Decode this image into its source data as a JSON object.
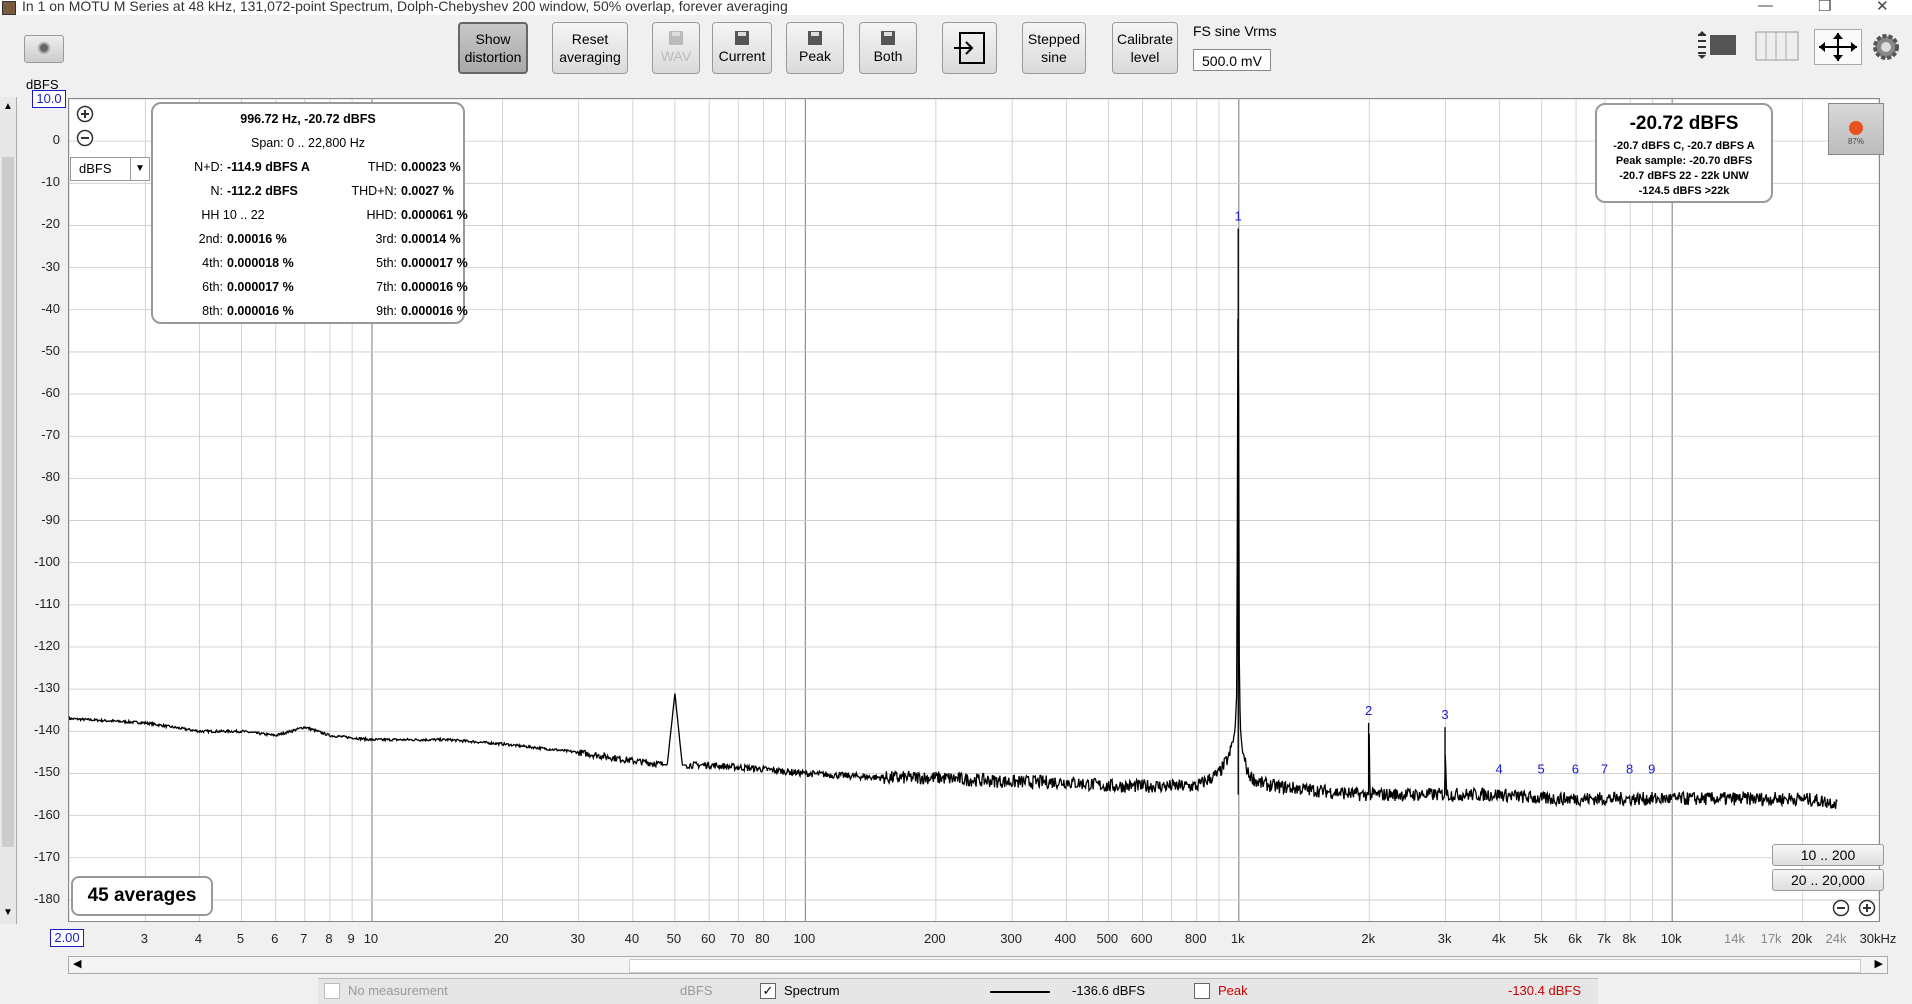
{
  "window": {
    "title": "In 1 on MOTU M Series at 48 kHz, 131,072-point Spectrum, Dolph-Chebyshev 200 window, 50% overlap, forever averaging"
  },
  "toolbar": {
    "show_distortion": "Show\ndistortion",
    "reset_averaging": "Reset\naveraging",
    "wav": "WAV",
    "current": "Current",
    "peak": "Peak",
    "both": "Both",
    "stepped_sine": "Stepped\nsine",
    "calibrate_level": "Calibrate\nlevel",
    "fs_label": "FS sine Vrms",
    "fs_value": "500.0 mV"
  },
  "axis": {
    "y_unit": "dBFS",
    "y_top_value": "10.0",
    "y_ticks": [
      "0",
      "-10",
      "-20",
      "-30",
      "-40",
      "-50",
      "-60",
      "-70",
      "-80",
      "-90",
      "-100",
      "-110",
      "-120",
      "-130",
      "-140",
      "-150",
      "-160",
      "-170",
      "-180"
    ],
    "unit_select": "dBFS",
    "x_start_value": "2.00",
    "x_ticks": [
      {
        "label": "3",
        "f": 3
      },
      {
        "label": "4",
        "f": 4
      },
      {
        "label": "5",
        "f": 5
      },
      {
        "label": "6",
        "f": 6
      },
      {
        "label": "7",
        "f": 7
      },
      {
        "label": "8",
        "f": 8
      },
      {
        "label": "9",
        "f": 9
      },
      {
        "label": "10",
        "f": 10
      },
      {
        "label": "20",
        "f": 20
      },
      {
        "label": "30",
        "f": 30
      },
      {
        "label": "40",
        "f": 40
      },
      {
        "label": "50",
        "f": 50
      },
      {
        "label": "60",
        "f": 60
      },
      {
        "label": "70",
        "f": 70
      },
      {
        "label": "80",
        "f": 80
      },
      {
        "label": "100",
        "f": 100
      },
      {
        "label": "200",
        "f": 200
      },
      {
        "label": "300",
        "f": 300
      },
      {
        "label": "400",
        "f": 400
      },
      {
        "label": "500",
        "f": 500
      },
      {
        "label": "600",
        "f": 600
      },
      {
        "label": "800",
        "f": 800
      },
      {
        "label": "1k",
        "f": 1000
      },
      {
        "label": "2k",
        "f": 2000
      },
      {
        "label": "3k",
        "f": 3000
      },
      {
        "label": "4k",
        "f": 4000
      },
      {
        "label": "5k",
        "f": 5000
      },
      {
        "label": "6k",
        "f": 6000
      },
      {
        "label": "7k",
        "f": 7000
      },
      {
        "label": "8k",
        "f": 8000
      },
      {
        "label": "10k",
        "f": 10000
      },
      {
        "label": "14k",
        "f": 14000,
        "grey": true
      },
      {
        "label": "17k",
        "f": 17000,
        "grey": true
      },
      {
        "label": "20k",
        "f": 20000
      },
      {
        "label": "24k",
        "f": 24000,
        "grey": true
      },
      {
        "label": "30kHz",
        "f": 30000
      }
    ]
  },
  "distortion_panel": {
    "header": "996.72 Hz, -20.72 dBFS",
    "span": "Span: 0 .. 22,800 Hz",
    "rows": [
      [
        "N+D:",
        "-114.9 dBFS A",
        "THD:",
        "0.00023 %"
      ],
      [
        "N:",
        "-112.2 dBFS",
        "THD+N:",
        "0.0027 %"
      ],
      [
        "HH 10 .. 22",
        "",
        "HHD:",
        "0.000061 %"
      ],
      [
        "2nd:",
        "0.00016 %",
        "3rd:",
        "0.00014 %"
      ],
      [
        "4th:",
        "0.000018 %",
        "5th:",
        "0.000017 %"
      ],
      [
        "6th:",
        "0.000017 %",
        "7th:",
        "0.000016 %"
      ],
      [
        "8th:",
        "0.000016 %",
        "9th:",
        "0.000016 %"
      ]
    ]
  },
  "level_panel": {
    "big": "-20.72 dBFS",
    "lines": [
      "-20.7 dBFS C, -20.7 dBFS A",
      "Peak sample: -20.70 dBFS",
      "-20.7 dBFS 22 - 22k UNW",
      "-124.5 dBFS >22k"
    ]
  },
  "meter_pct": "87%",
  "averages": "45 averages",
  "range_buttons": [
    "10 .. 200",
    "20 .. 20,000"
  ],
  "harmonic_markers": [
    "1",
    "2",
    "3",
    "4",
    "5",
    "6",
    "7",
    "8",
    "9"
  ],
  "status_bar": {
    "no_measurement": "No measurement",
    "unit": "dBFS",
    "spectrum": "Spectrum",
    "spectrum_value": "-136.6 dBFS",
    "peak": "Peak",
    "peak_value": "-130.4 dBFS"
  },
  "colors": {
    "trace": "#000000",
    "marker": "#1a1acc",
    "peak": "#cc0000",
    "grid": "#c8c8c8"
  },
  "chart_data": {
    "type": "line",
    "xscale": "log",
    "xlim": [
      2,
      30000
    ],
    "ylim": [
      -185,
      10
    ],
    "spectrum": {
      "name": "Spectrum",
      "x": [
        2,
        3,
        4,
        5,
        6,
        7,
        8,
        10,
        15,
        20,
        30,
        40,
        48,
        50,
        52,
        60,
        80,
        100,
        150,
        200,
        300,
        400,
        500,
        600,
        700,
        800,
        900,
        950,
        980,
        990,
        996.72,
        1003,
        1010,
        1020,
        1050,
        1100,
        1200,
        1500,
        1900,
        1993,
        2000,
        2007,
        2100,
        2500,
        2980,
        2990,
        3000,
        3010,
        3100,
        4000,
        5000,
        6000,
        8000,
        10000,
        14000,
        20000,
        24000
      ],
      "y": [
        -137,
        -138,
        -140,
        -140,
        -141,
        -139,
        -141,
        -142,
        -142,
        -143,
        -145,
        -147,
        -148,
        -131,
        -148,
        -148,
        -149,
        -150,
        -151,
        -151,
        -152,
        -152,
        -153,
        -153,
        -153,
        -153,
        -150,
        -146,
        -140,
        -130,
        -20.72,
        -130,
        -140,
        -145,
        -150,
        -152,
        -153,
        -154,
        -155,
        -155,
        -138,
        -155,
        -155,
        -155,
        -155,
        -155,
        -139,
        -155,
        -155,
        -155,
        -156,
        -156,
        -156,
        -156,
        -156,
        -156,
        -157
      ]
    },
    "harmonics": [
      {
        "n": "1",
        "f": 996.72,
        "db": -20.72
      },
      {
        "n": "2",
        "f": 1993,
        "db": -138
      },
      {
        "n": "3",
        "f": 2990,
        "db": -139
      },
      {
        "n": "4",
        "f": 3987
      },
      {
        "n": "5",
        "f": 4984
      },
      {
        "n": "6",
        "f": 5980
      },
      {
        "n": "7",
        "f": 6977
      },
      {
        "n": "8",
        "f": 7974
      },
      {
        "n": "9",
        "f": 8970
      }
    ]
  }
}
